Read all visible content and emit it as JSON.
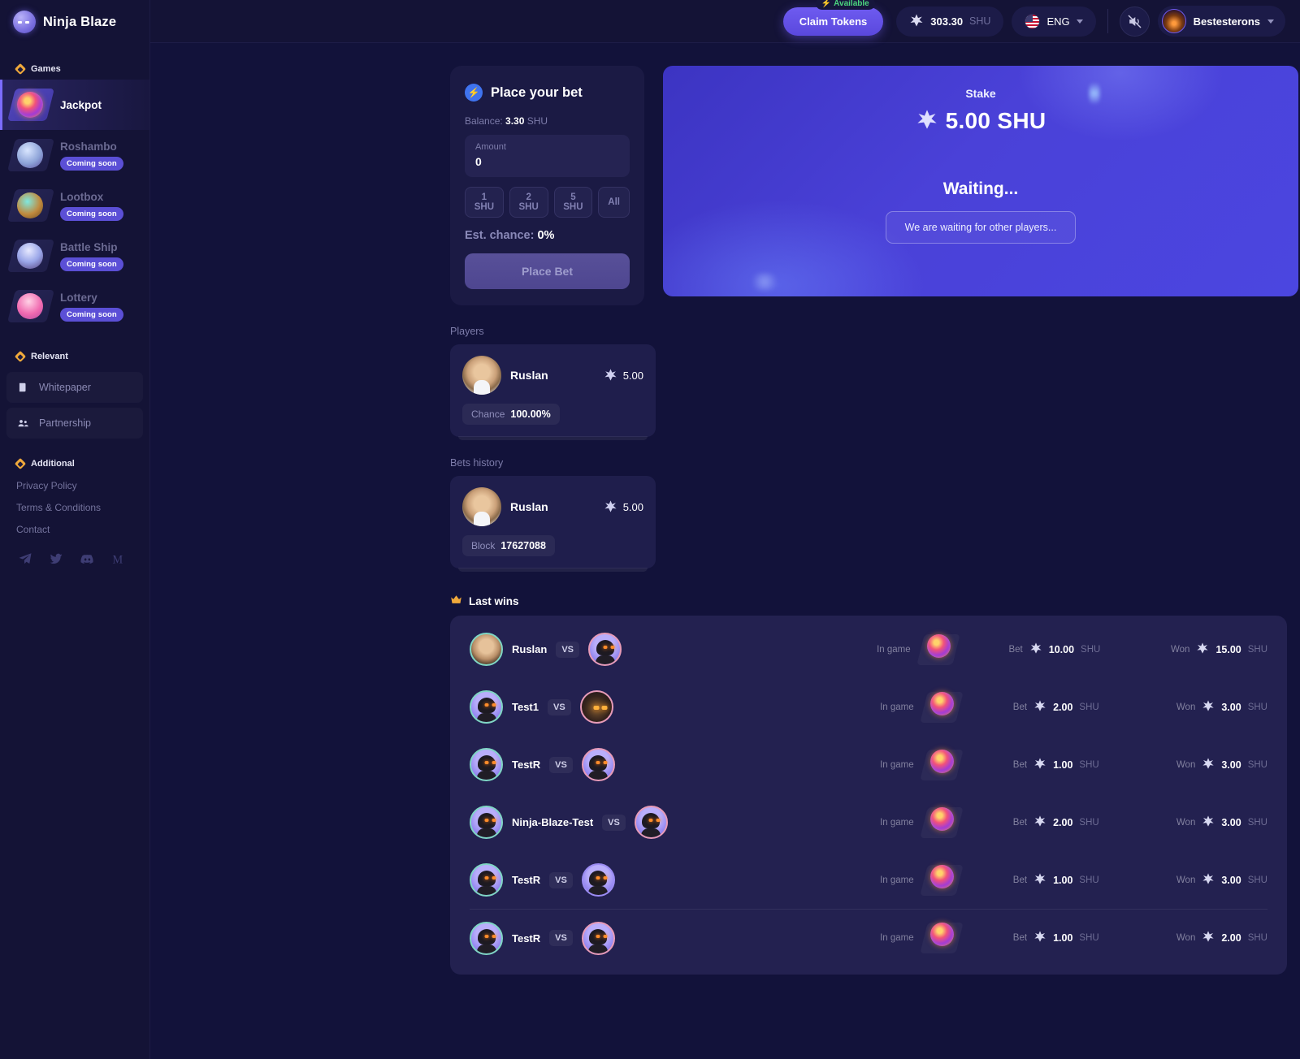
{
  "brand": {
    "name": "Ninja Blaze",
    "logo_icon": "ninja-logo-icon"
  },
  "sidebar": {
    "games_label": "Games",
    "games": [
      {
        "label": "Jackpot",
        "badge": "",
        "icon": "jackpot-orb-icon",
        "active": true
      },
      {
        "label": "Roshambo",
        "badge": "Coming soon",
        "icon": "roshambo-orb-icon",
        "active": false
      },
      {
        "label": "Lootbox",
        "badge": "Coming soon",
        "icon": "lootbox-orb-icon",
        "active": false
      },
      {
        "label": "Battle Ship",
        "badge": "Coming soon",
        "icon": "ship-orb-icon",
        "active": false
      },
      {
        "label": "Lottery",
        "badge": "Coming soon",
        "icon": "lottery-orb-icon",
        "active": false
      }
    ],
    "relevant_label": "Relevant",
    "relevant": [
      {
        "label": "Whitepaper",
        "icon": "document-icon"
      },
      {
        "label": "Partnership",
        "icon": "people-icon"
      }
    ],
    "additional_label": "Additional",
    "additional": [
      {
        "label": "Privacy Policy"
      },
      {
        "label": "Terms & Conditions"
      },
      {
        "label": "Contact"
      }
    ],
    "socials": [
      {
        "name": "telegram-icon"
      },
      {
        "name": "twitter-icon"
      },
      {
        "name": "discord-icon"
      },
      {
        "name": "medium-icon"
      }
    ]
  },
  "topbar": {
    "available_label": "Available",
    "claim_label": "Claim Tokens",
    "balance": "303.30",
    "balance_unit": "SHU",
    "language": "ENG",
    "sound_icon": "sound-muted-icon",
    "user": "Bestesterons"
  },
  "bet_panel": {
    "title": "Place your bet",
    "title_icon": "bolt-icon",
    "balance_label": "Balance:",
    "balance_value": "3.30",
    "balance_unit": "SHU",
    "amount_label": "Amount",
    "amount_value": "0",
    "amount_placeholder": "0",
    "quick_amounts": [
      "1 SHU",
      "2 SHU",
      "5 SHU",
      "All"
    ],
    "chance_label": "Est. chance:",
    "chance_value": "0%",
    "place_bet_label": "Place Bet"
  },
  "stake_panel": {
    "stake_label": "Stake",
    "stake_amount": "5.00 SHU",
    "status_title": "Waiting...",
    "status_note": "We are waiting for other players..."
  },
  "players": {
    "title": "Players",
    "items": [
      {
        "name": "Ruslan",
        "amount": "5.00",
        "tag_key": "Chance",
        "tag_value": "100.00%"
      }
    ]
  },
  "bets_history": {
    "title": "Bets history",
    "items": [
      {
        "name": "Ruslan",
        "amount": "5.00",
        "tag_key": "Block",
        "tag_value": "17627088"
      }
    ]
  },
  "last_wins": {
    "title": "Last wins",
    "title_icon": "crown-icon",
    "in_game_label": "In game",
    "bet_label": "Bet",
    "won_label": "Won",
    "unit": "SHU",
    "rows": [
      {
        "player": "Ruslan",
        "left_avatar": "human-avatar",
        "right_avatar": "ninja-avatar",
        "vs": "VS",
        "game_icon": "jackpot-orb-icon",
        "bet": "10.00",
        "won": "15.00",
        "sep": false
      },
      {
        "player": "Test1",
        "left_avatar": "ninja-avatar",
        "right_avatar": "demon-avatar",
        "vs": "VS",
        "game_icon": "jackpot-orb-icon",
        "bet": "2.00",
        "won": "3.00",
        "sep": false
      },
      {
        "player": "TestR",
        "left_avatar": "ninja-avatar",
        "right_avatar": "ninja-avatar",
        "vs": "VS",
        "game_icon": "jackpot-orb-icon",
        "bet": "1.00",
        "won": "3.00",
        "sep": false
      },
      {
        "player": "Ninja-Blaze-Test",
        "left_avatar": "ninja-avatar",
        "right_avatar": "ninja-avatar",
        "vs": "VS",
        "game_icon": "jackpot-orb-icon",
        "bet": "2.00",
        "won": "3.00",
        "sep": false
      },
      {
        "player": "TestR",
        "left_avatar": "ninja-avatar",
        "right_avatar": "ninja-avatar",
        "vs": "VS",
        "game_icon": "jackpot-orb-icon",
        "bet": "1.00",
        "won": "3.00",
        "sep": false
      },
      {
        "player": "TestR",
        "left_avatar": "ninja-avatar",
        "right_avatar": "ninja-avatar",
        "vs": "VS",
        "game_icon": "jackpot-orb-icon",
        "bet": "1.00",
        "won": "2.00",
        "sep": true
      }
    ]
  },
  "colors": {
    "page_bg": "#12123a",
    "sidebar_bg": "#141336",
    "card_bg": "#1b1a44",
    "accent_purple": "#6e5bf0",
    "accent_orange": "#f0a93b",
    "available_green": "#4cd77f",
    "stake_blue": "#4a41d8"
  }
}
